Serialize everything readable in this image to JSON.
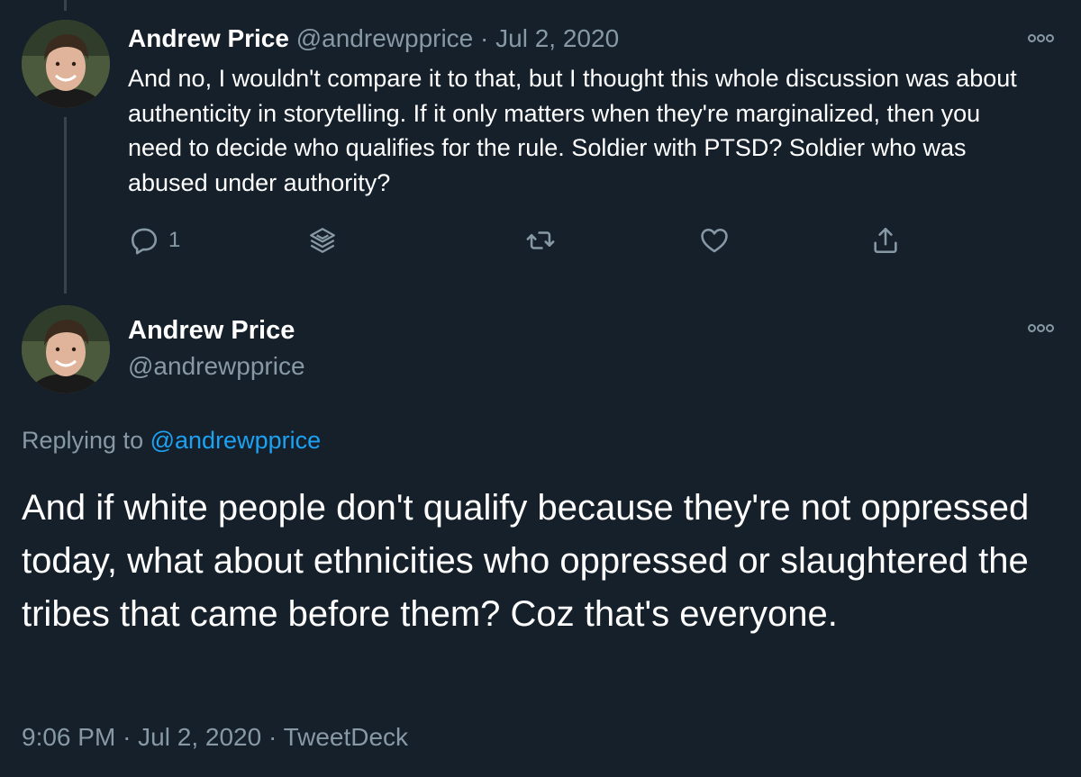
{
  "colors": {
    "background": "#15202b",
    "text_primary": "#ffffff",
    "text_secondary": "#8899a6",
    "link": "#1da1f2",
    "thread_line": "#38444d"
  },
  "tweet1": {
    "author_name": "Andrew Price",
    "handle": "@andrewpprice",
    "separator": "·",
    "date": "Jul 2, 2020",
    "text": "And no, I wouldn't compare it to that, but I thought this whole discussion was about authenticity in storytelling. If it only matters when they're marginalized, then you need to decide who qualifies for the rule. Soldier with PTSD? Soldier who was abused under authority?",
    "actions": {
      "reply_icon": "reply-icon",
      "reply_count": "1",
      "stack_icon": "stack-icon",
      "retweet_icon": "retweet-icon",
      "like_icon": "heart-icon",
      "share_icon": "share-icon"
    },
    "more_icon": "more-icon"
  },
  "tweet2": {
    "author_name": "Andrew Price",
    "handle": "@andrewpprice",
    "replying_prefix": "Replying to",
    "replying_to": "@andrewpprice",
    "text": "And if white people don't qualify because they're not oppressed today, what about ethnicities who oppressed or slaughtered the tribes that came before them? Coz that's everyone.",
    "time": "9:06 PM",
    "separator": "·",
    "date": "Jul 2, 2020",
    "source": "TweetDeck",
    "more_icon": "more-icon"
  }
}
